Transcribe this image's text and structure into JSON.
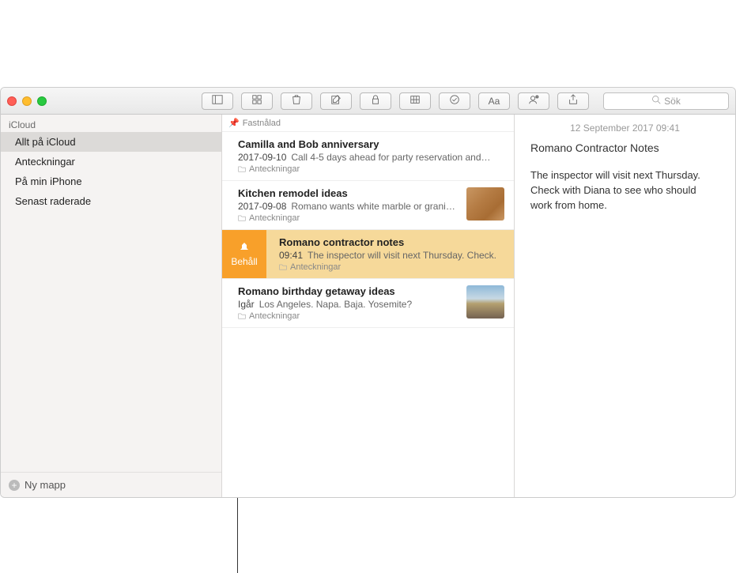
{
  "toolbar": {
    "search_placeholder": "Sök"
  },
  "sidebar": {
    "account_label": "iCloud",
    "folders": [
      {
        "label": "Allt på iCloud",
        "selected": true
      },
      {
        "label": "Anteckningar",
        "selected": false
      },
      {
        "label": "På min iPhone",
        "selected": false
      },
      {
        "label": "Senast raderade",
        "selected": false
      }
    ],
    "new_folder_label": "Ny mapp"
  },
  "list": {
    "pinned_header": "Fastnålad",
    "notes": [
      {
        "title": "Camilla and Bob anniversary",
        "date": "2017-09-10",
        "snippet": "Call 4-5 days ahead for party reservation and…",
        "folder": "Anteckningar",
        "thumb": null,
        "selected": false
      },
      {
        "title": "Kitchen remodel ideas",
        "date": "2017-09-08",
        "snippet": "Romano wants white marble or grani…",
        "folder": "Anteckningar",
        "thumb": "wood",
        "selected": false
      },
      {
        "title": "Romano contractor notes",
        "date": "09:41",
        "snippet": "The inspector will visit next Thursday. Check.",
        "folder": "Anteckningar",
        "thumb": null,
        "selected": true,
        "pin_action_label": "Behåll"
      },
      {
        "title": "Romano birthday getaway ideas",
        "date": "Igår",
        "snippet": "Los Angeles. Napa. Baja. Yosemite?",
        "folder": "Anteckningar",
        "thumb": "beach",
        "selected": false
      }
    ]
  },
  "editor": {
    "timestamp": "12 September 2017 09:41",
    "title": "Romano Contractor Notes",
    "body": "The inspector will visit next Thursday. Check with Diana to see who should work from home."
  }
}
